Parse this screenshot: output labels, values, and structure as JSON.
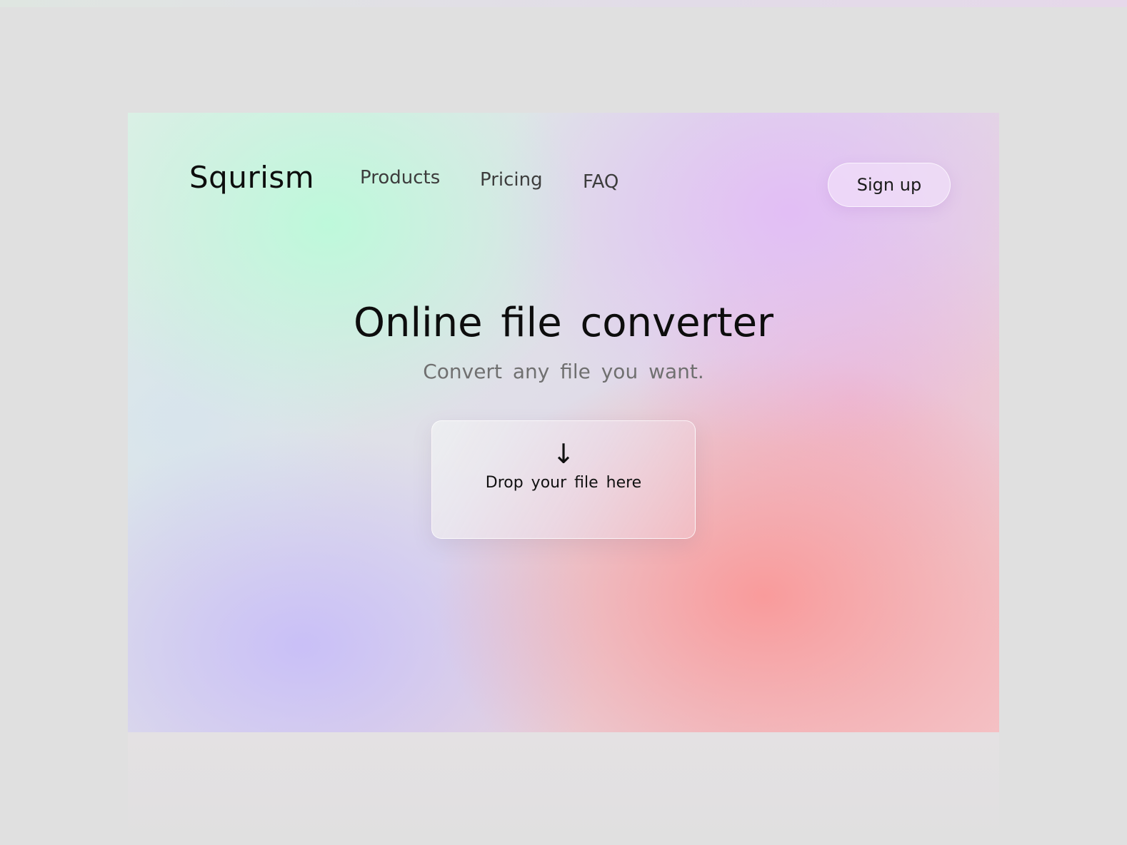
{
  "brand": {
    "name": "Squrism"
  },
  "nav": {
    "items": [
      {
        "label": "Products"
      },
      {
        "label": "Pricing"
      },
      {
        "label": "FAQ"
      }
    ],
    "signup_label": "Sign up"
  },
  "hero": {
    "title": "Online file converter",
    "subtitle": "Convert any file you want."
  },
  "dropzone": {
    "icon": "arrow-down-icon",
    "icon_glyph": "↓",
    "label": "Drop your file here"
  },
  "colors": {
    "page_background": "#e0e0e0",
    "text_primary": "#0d0d0d",
    "text_secondary": "#707070",
    "gradient_mint": "#bcfada",
    "gradient_lilac": "#e2bcf6",
    "gradient_coral": "#fa9898",
    "gradient_periwinkle": "#c8bef8"
  }
}
